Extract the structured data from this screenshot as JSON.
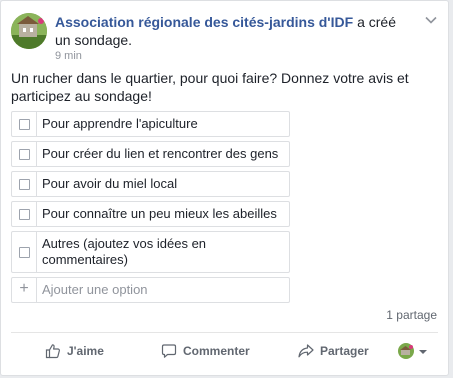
{
  "post": {
    "author": "Association régionale des cités-jardins d'IDF",
    "action_text": " a créé un sondage.",
    "time": "9 min",
    "question": "Un rucher dans le quartier, pour quoi faire? Donnez votre avis et participez au sondage!"
  },
  "poll": {
    "options": [
      "Pour apprendre l'apiculture",
      "Pour créer du lien et rencontrer des gens",
      "Pour avoir du miel local",
      "Pour connaître un peu mieux les abeilles",
      "Autres (ajoutez vos idées en commentaires)"
    ],
    "add_placeholder": "Ajouter une option"
  },
  "footer": {
    "shares": "1 partage",
    "like": "J'aime",
    "comment": "Commenter",
    "share": "Partager"
  },
  "colors": {
    "author": "#365899",
    "background": "#e9ebee",
    "action_text": "#616770"
  }
}
